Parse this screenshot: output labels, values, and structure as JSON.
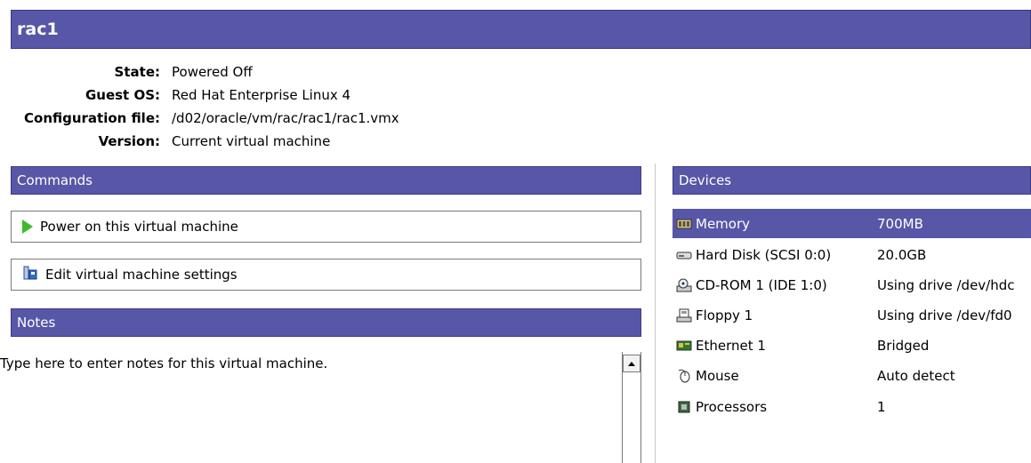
{
  "vm": {
    "title": "rac1"
  },
  "info": [
    {
      "label": "State:",
      "value": "Powered Off"
    },
    {
      "label": "Guest OS:",
      "value": "Red Hat Enterprise Linux 4"
    },
    {
      "label": "Configuration file:",
      "value": "/d02/oracle/vm/rac/rac1/rac1.vmx"
    },
    {
      "label": "Version:",
      "value": "Current virtual machine"
    }
  ],
  "commands": {
    "header": "Commands",
    "power_on": "Power on this virtual machine",
    "edit_settings": "Edit virtual machine settings"
  },
  "notes": {
    "header": "Notes",
    "text": "Type here to enter notes for this virtual machine."
  },
  "devices": {
    "header": "Devices",
    "items": [
      {
        "name": "Memory",
        "value": "700MB",
        "icon": "memory-icon"
      },
      {
        "name": "Hard Disk (SCSI 0:0)",
        "value": "20.0GB",
        "icon": "hard-disk-icon"
      },
      {
        "name": "CD-ROM 1 (IDE 1:0)",
        "value": "Using drive /dev/hdc",
        "icon": "cdrom-icon"
      },
      {
        "name": "Floppy 1",
        "value": "Using drive /dev/fd0",
        "icon": "floppy-icon"
      },
      {
        "name": "Ethernet 1",
        "value": "Bridged",
        "icon": "ethernet-icon"
      },
      {
        "name": "Mouse",
        "value": "Auto detect",
        "icon": "mouse-icon"
      },
      {
        "name": "Processors",
        "value": "1",
        "icon": "processor-icon"
      }
    ]
  },
  "colors": {
    "header_bg": "#5856a6",
    "selection_bg": "#5856a6",
    "play_green": "#3dbb2c"
  }
}
